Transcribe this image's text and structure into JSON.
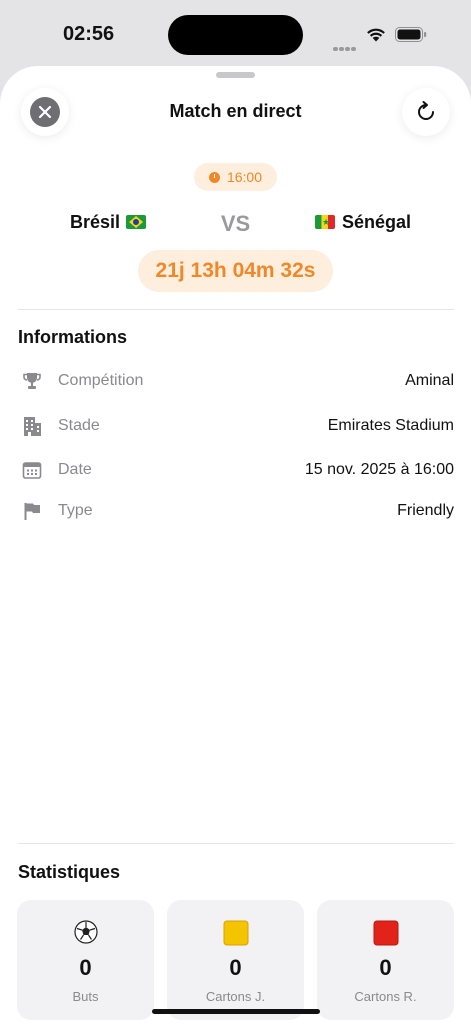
{
  "status_bar": {
    "time": "02:56"
  },
  "header": {
    "title": "Match en direct"
  },
  "match": {
    "kickoff_time": "16:00",
    "home_team": "Brésil",
    "away_team": "Sénégal",
    "vs_label": "VS",
    "countdown": "21j 13h 04m 32s"
  },
  "info": {
    "title": "Informations",
    "rows": [
      {
        "label": "Compétition",
        "value": "Aminal",
        "icon": "trophy-icon"
      },
      {
        "label": "Stade",
        "value": "Emirates Stadium",
        "icon": "building-icon"
      },
      {
        "label": "Date",
        "value": "15 nov. 2025 à 16:00",
        "icon": "calendar-icon"
      },
      {
        "label": "Type",
        "value": "Friendly",
        "icon": "flag-icon"
      }
    ]
  },
  "stats": {
    "title": "Statistiques",
    "cards": [
      {
        "value": "0",
        "label": "Buts",
        "icon": "soccer-ball-icon"
      },
      {
        "value": "0",
        "label": "Cartons J.",
        "icon": "yellow-card-icon"
      },
      {
        "value": "0",
        "label": "Cartons R.",
        "icon": "red-card-icon"
      }
    ]
  },
  "colors": {
    "accent": "#f0882a",
    "accent_bg": "#fdeedd",
    "card_bg": "#f2f2f5",
    "muted": "#8a8a8e"
  }
}
